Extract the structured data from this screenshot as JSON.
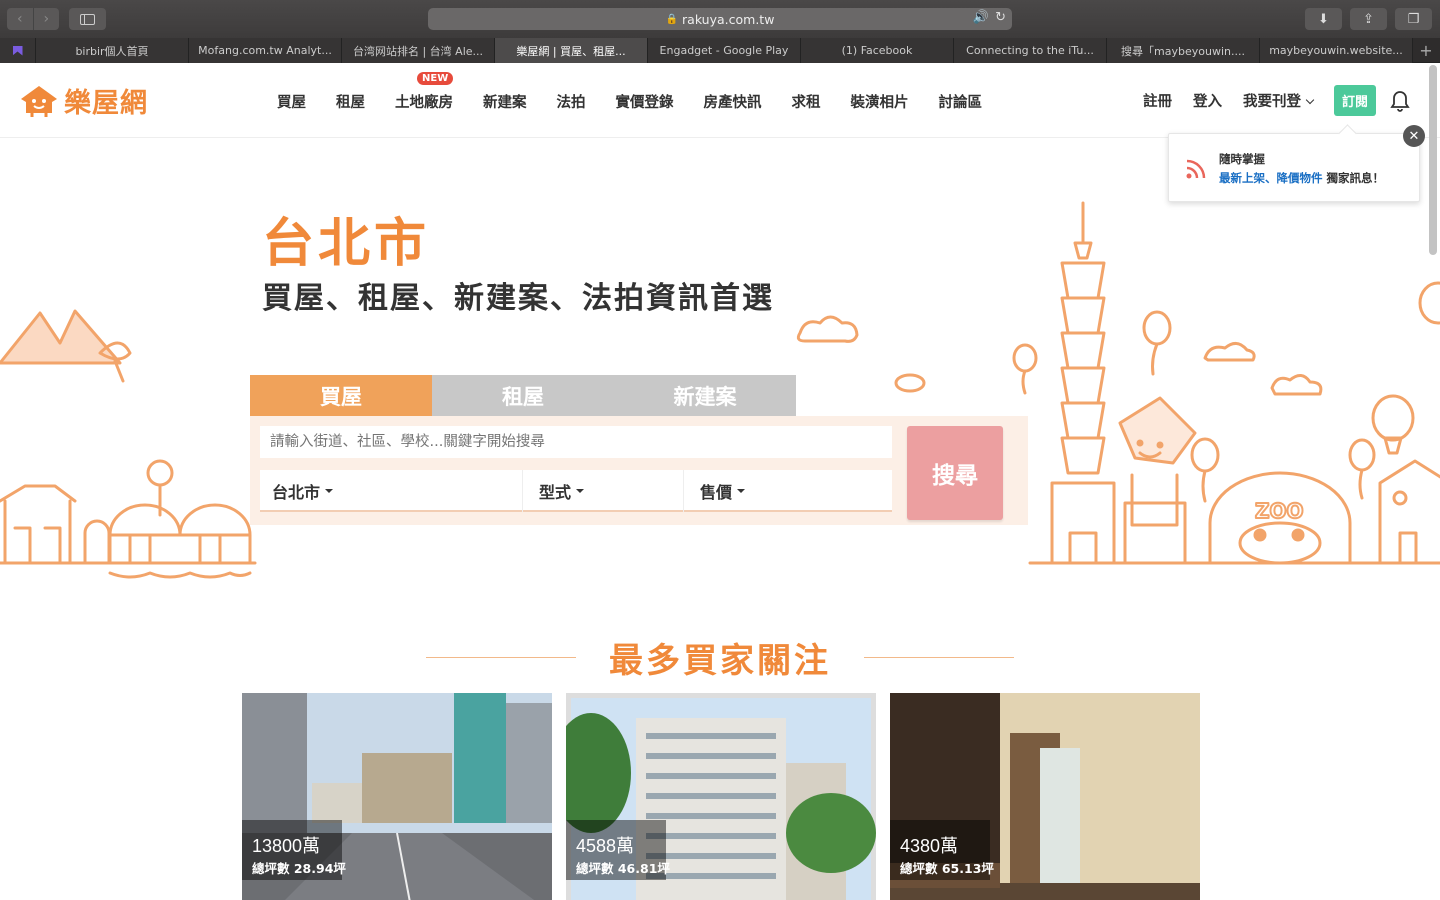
{
  "browser": {
    "url": "rakuya.com.tw",
    "tabs": [
      {
        "label": "birbir個人首頁",
        "active": false
      },
      {
        "label": "Mofang.com.tw Analyt...",
        "active": false
      },
      {
        "label": "台湾网站排名 | 台湾 Ale...",
        "active": false
      },
      {
        "label": "樂屋網 | 買屋、租屋...",
        "active": true
      },
      {
        "label": "Engadget - Google Play",
        "active": false
      },
      {
        "label": "(1) Facebook",
        "active": false
      },
      {
        "label": "Connecting to the iTu...",
        "active": false
      },
      {
        "label": "搜尋「maybeyouwin....",
        "active": false
      },
      {
        "label": "maybeyouwin.website...",
        "active": false
      }
    ]
  },
  "header": {
    "logo_text": "樂屋網",
    "nav": [
      "買屋",
      "租屋",
      "土地廠房",
      "新建案",
      "法拍",
      "實價登錄",
      "房產快訊",
      "求租",
      "裝潢相片",
      "討論區"
    ],
    "new_badge": "NEW",
    "register": "註冊",
    "login": "登入",
    "post": "我要刊登",
    "subscribe": "訂閱"
  },
  "notice": {
    "title": "隨時掌握",
    "link1": "最新上架",
    "sep": "、",
    "link2": "降價物件",
    "tail": " 獨家訊息！",
    "close": "✕"
  },
  "hero": {
    "city": "台北市",
    "subtitle": "買屋、租屋、新建案、法拍資訊首選"
  },
  "search": {
    "tabs": [
      {
        "label": "買屋",
        "active": true
      },
      {
        "label": "租屋",
        "active": false
      },
      {
        "label": "新建案",
        "active": false
      }
    ],
    "placeholder": "請輸入街道、社區、學校...關鍵字開始搜尋",
    "city": "台北市",
    "type": "型式",
    "price": "售價",
    "button": "搜尋"
  },
  "section": {
    "title": "最多買家關注"
  },
  "listings": [
    {
      "price": "13800萬",
      "area": "總坪數 28.94坪"
    },
    {
      "price": "4588萬",
      "area": "總坪數 46.81坪"
    },
    {
      "price": "4380萬",
      "area": "總坪數 65.13坪"
    }
  ],
  "colors": {
    "brand_orange": "#f0893a",
    "search_tab_active": "#f0a25a",
    "search_button": "#ec9fa0",
    "subscribe_green": "#4cc99a",
    "new_badge_red": "#e74b3c",
    "link_blue": "#1a6fc4"
  }
}
